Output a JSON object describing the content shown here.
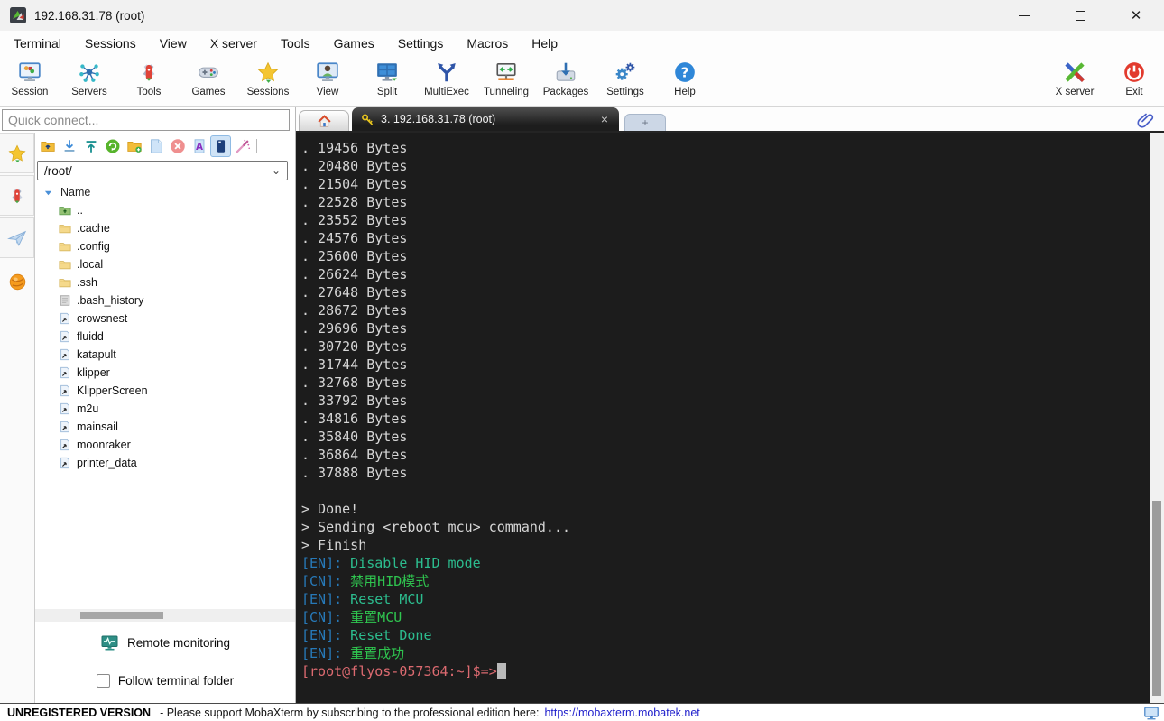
{
  "window": {
    "title": "192.168.31.78 (root)"
  },
  "menu": [
    "Terminal",
    "Sessions",
    "View",
    "X server",
    "Tools",
    "Games",
    "Settings",
    "Macros",
    "Help"
  ],
  "toolbar": {
    "left": [
      {
        "label": "Session",
        "icon": "session-icon"
      },
      {
        "label": "Servers",
        "icon": "servers-icon"
      },
      {
        "label": "Tools",
        "icon": "tools-knife-icon"
      },
      {
        "label": "Games",
        "icon": "games-icon"
      },
      {
        "label": "Sessions",
        "icon": "sessions-star-icon"
      },
      {
        "label": "View",
        "icon": "view-icon"
      },
      {
        "label": "Split",
        "icon": "split-icon"
      },
      {
        "label": "MultiExec",
        "icon": "multiexec-icon"
      },
      {
        "label": "Tunneling",
        "icon": "tunneling-icon"
      },
      {
        "label": "Packages",
        "icon": "packages-icon"
      },
      {
        "label": "Settings",
        "icon": "settings-gear-icon"
      },
      {
        "label": "Help",
        "icon": "help-icon"
      }
    ],
    "right": [
      {
        "label": "X server",
        "icon": "xserver-icon"
      },
      {
        "label": "Exit",
        "icon": "exit-power-icon"
      }
    ]
  },
  "sidebar": {
    "quick_connect_placeholder": "Quick connect...",
    "strip_tabs": [
      "sessions-star-icon",
      "tools-knife-icon",
      "macros-plane-icon"
    ],
    "strip_globe": "sftp-globe-icon",
    "file_toolbar": [
      "parent-folder-icon",
      "download-icon",
      "upload-icon",
      "refresh-icon",
      "new-folder-icon",
      "new-file-icon",
      "delete-icon",
      "rename-icon",
      "side-panel-icon",
      "wand-icon"
    ],
    "file_toolbar_selected_index": 8,
    "path": "/root/",
    "list_header": "Name",
    "files": [
      {
        "name": "..",
        "icon": "folder-up"
      },
      {
        "name": ".cache",
        "icon": "folder"
      },
      {
        "name": ".config",
        "icon": "folder"
      },
      {
        "name": ".local",
        "icon": "folder"
      },
      {
        "name": ".ssh",
        "icon": "folder"
      },
      {
        "name": ".bash_history",
        "icon": "file"
      },
      {
        "name": "crowsnest",
        "icon": "link"
      },
      {
        "name": "fluidd",
        "icon": "link"
      },
      {
        "name": "katapult",
        "icon": "link"
      },
      {
        "name": "klipper",
        "icon": "link"
      },
      {
        "name": "KlipperScreen",
        "icon": "link"
      },
      {
        "name": "m2u",
        "icon": "link"
      },
      {
        "name": "mainsail",
        "icon": "link"
      },
      {
        "name": "moonraker",
        "icon": "link"
      },
      {
        "name": "printer_data",
        "icon": "link"
      }
    ],
    "remote_monitoring_label": "Remote monitoring",
    "follow_terminal_folder_label": "Follow terminal folder",
    "follow_checked": false
  },
  "tabs": {
    "home_icon": "home-icon",
    "active_label": "3. 192.168.31.78 (root)",
    "active_icon": "key-icon",
    "close_glyph": "×",
    "plus_glyph": "+",
    "attach_icon": "paperclip-icon"
  },
  "terminal": {
    "lines": [
      {
        "s": [
          {
            "t": ". 19456 Bytes",
            "c": "plain"
          }
        ]
      },
      {
        "s": [
          {
            "t": ". 20480 Bytes",
            "c": "plain"
          }
        ]
      },
      {
        "s": [
          {
            "t": ". 21504 Bytes",
            "c": "plain"
          }
        ]
      },
      {
        "s": [
          {
            "t": ". 22528 Bytes",
            "c": "plain"
          }
        ]
      },
      {
        "s": [
          {
            "t": ". 23552 Bytes",
            "c": "plain"
          }
        ]
      },
      {
        "s": [
          {
            "t": ". 24576 Bytes",
            "c": "plain"
          }
        ]
      },
      {
        "s": [
          {
            "t": ". 25600 Bytes",
            "c": "plain"
          }
        ]
      },
      {
        "s": [
          {
            "t": ". 26624 Bytes",
            "c": "plain"
          }
        ]
      },
      {
        "s": [
          {
            "t": ". 27648 Bytes",
            "c": "plain"
          }
        ]
      },
      {
        "s": [
          {
            "t": ". 28672 Bytes",
            "c": "plain"
          }
        ]
      },
      {
        "s": [
          {
            "t": ". 29696 Bytes",
            "c": "plain"
          }
        ]
      },
      {
        "s": [
          {
            "t": ". 30720 Bytes",
            "c": "plain"
          }
        ]
      },
      {
        "s": [
          {
            "t": ". 31744 Bytes",
            "c": "plain"
          }
        ]
      },
      {
        "s": [
          {
            "t": ". 32768 Bytes",
            "c": "plain"
          }
        ]
      },
      {
        "s": [
          {
            "t": ". 33792 Bytes",
            "c": "plain"
          }
        ]
      },
      {
        "s": [
          {
            "t": ". 34816 Bytes",
            "c": "plain"
          }
        ]
      },
      {
        "s": [
          {
            "t": ". 35840 Bytes",
            "c": "plain"
          }
        ]
      },
      {
        "s": [
          {
            "t": ". 36864 Bytes",
            "c": "plain"
          }
        ]
      },
      {
        "s": [
          {
            "t": ". 37888 Bytes",
            "c": "plain"
          }
        ]
      },
      {
        "s": []
      },
      {
        "s": [
          {
            "t": "> Done!",
            "c": "plain"
          }
        ]
      },
      {
        "s": [
          {
            "t": "> Sending <reboot mcu> command...",
            "c": "plain"
          }
        ]
      },
      {
        "s": [
          {
            "t": "> Finish",
            "c": "plain"
          }
        ]
      },
      {
        "s": [
          {
            "t": "[EN]:",
            "c": "blue"
          },
          {
            "t": " Disable HID mode",
            "c": "teal"
          }
        ]
      },
      {
        "s": [
          {
            "t": "[CN]:",
            "c": "blue"
          },
          {
            "t": " 禁用HID模式",
            "c": "lime"
          }
        ]
      },
      {
        "s": [
          {
            "t": "[EN]:",
            "c": "blue"
          },
          {
            "t": " Reset MCU",
            "c": "teal"
          }
        ]
      },
      {
        "s": [
          {
            "t": "[CN]:",
            "c": "blue"
          },
          {
            "t": " 重置MCU",
            "c": "lime"
          }
        ]
      },
      {
        "s": [
          {
            "t": "[EN]:",
            "c": "blue"
          },
          {
            "t": " Reset Done",
            "c": "teal"
          }
        ]
      },
      {
        "s": [
          {
            "t": "[EN]:",
            "c": "blue"
          },
          {
            "t": " 重置成功",
            "c": "lime"
          }
        ]
      },
      {
        "s": [
          {
            "t": "[root@flyos-057364:~]$=>",
            "c": "prompt"
          },
          {
            "t": "",
            "c": "cursor"
          }
        ]
      }
    ]
  },
  "statusbar": {
    "unregistered": "UNREGISTERED VERSION",
    "message": "-  Please support MobaXterm by subscribing to the professional edition here:",
    "link": "https://mobaxterm.mobatek.net"
  },
  "colors": {
    "terminal_bg": "#1c1c1c",
    "terminal_fg": "#d6d6d6",
    "label_blue": "#2779b8",
    "message_teal": "#2cbc8e",
    "message_green": "#2fc44f",
    "prompt_salmon": "#dc6a70",
    "cursor_gray": "#b9b9b9",
    "link_blue": "#2020cc",
    "tab_dark": "#1d1d1d"
  }
}
